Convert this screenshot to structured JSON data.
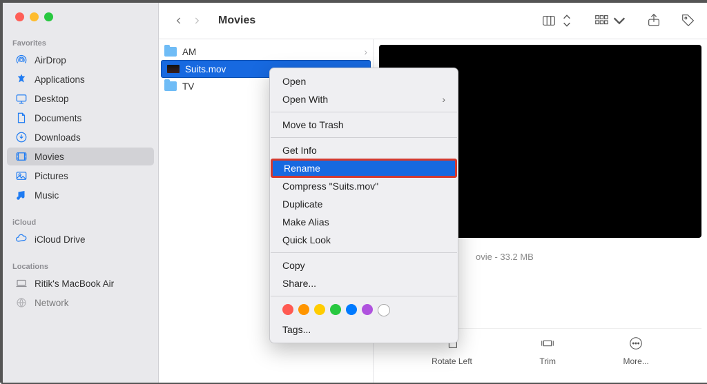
{
  "window_title": "Movies",
  "sidebar": {
    "sections": [
      {
        "label": "Favorites",
        "items": [
          {
            "id": "airdrop",
            "label": "AirDrop",
            "icon": "airdrop"
          },
          {
            "id": "applications",
            "label": "Applications",
            "icon": "apps"
          },
          {
            "id": "desktop",
            "label": "Desktop",
            "icon": "desktop"
          },
          {
            "id": "documents",
            "label": "Documents",
            "icon": "doc"
          },
          {
            "id": "downloads",
            "label": "Downloads",
            "icon": "download"
          },
          {
            "id": "movies",
            "label": "Movies",
            "icon": "movies",
            "selected": true
          },
          {
            "id": "pictures",
            "label": "Pictures",
            "icon": "pictures"
          },
          {
            "id": "music",
            "label": "Music",
            "icon": "music"
          }
        ]
      },
      {
        "label": "iCloud",
        "items": [
          {
            "id": "icloud",
            "label": "iCloud Drive",
            "icon": "cloud"
          }
        ]
      },
      {
        "label": "Locations",
        "items": [
          {
            "id": "mbair",
            "label": "Ritik's MacBook Air",
            "icon": "laptop"
          },
          {
            "id": "network",
            "label": "Network",
            "icon": "globe"
          }
        ]
      }
    ]
  },
  "column_items": [
    {
      "name": "AM",
      "icon": "folder",
      "has_children": true
    },
    {
      "name": "Suits.mov",
      "icon": "mov",
      "selected": true
    },
    {
      "name": "TV",
      "icon": "folder",
      "has_children": true
    }
  ],
  "preview": {
    "kind_size": "ovie - 33.2 MB",
    "actions": [
      {
        "id": "rotate",
        "label": "Rotate Left"
      },
      {
        "id": "trim",
        "label": "Trim"
      },
      {
        "id": "more",
        "label": "More..."
      }
    ]
  },
  "context_menu": {
    "groups": [
      [
        {
          "label": "Open"
        },
        {
          "label": "Open With",
          "submenu": true
        }
      ],
      [
        {
          "label": "Move to Trash"
        }
      ],
      [
        {
          "label": "Get Info"
        },
        {
          "label": "Rename",
          "highlighted": true
        },
        {
          "label": "Compress \"Suits.mov\""
        },
        {
          "label": "Duplicate"
        },
        {
          "label": "Make Alias"
        },
        {
          "label": "Quick Look"
        }
      ],
      [
        {
          "label": "Copy"
        },
        {
          "label": "Share..."
        }
      ]
    ],
    "tags_colors": [
      "#ff5a52",
      "#ff9500",
      "#ffcc00",
      "#28c840",
      "#007aff",
      "#af52de"
    ],
    "tags_label": "Tags..."
  }
}
